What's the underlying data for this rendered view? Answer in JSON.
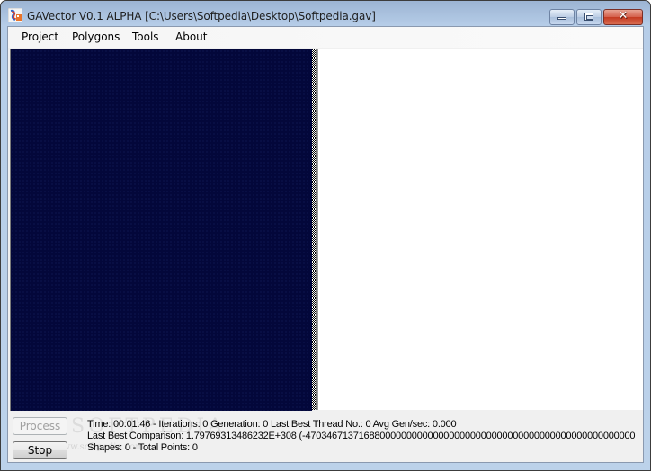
{
  "window": {
    "title": "GAVector V0.1 ALPHA [C:\\Users\\Softpedia\\Desktop\\Softpedia.gav]",
    "icon": "app-icon",
    "controls": {
      "minimize": "minimize-icon",
      "maximize": "maximize-icon",
      "close": "close-icon",
      "close_glyph": "✕"
    }
  },
  "menu": {
    "items": [
      {
        "label": "Project"
      },
      {
        "label": "Polygons"
      },
      {
        "label": "Tools"
      },
      {
        "label": "About"
      }
    ]
  },
  "canvas": {
    "source_color": "#03073a",
    "result_color": "#ffffff"
  },
  "controls": {
    "process_label": "Process",
    "process_enabled": false,
    "stop_label": "Stop"
  },
  "status": {
    "line1": "Time: 00:01:46 - Iterations: 0 Generation: 0 Last Best Thread No.: 0 Avg Gen/sec: 0.000",
    "line2": "Last Best Comparison: 1.79769313486232E+308 (-47034671371688000000000000000000000000000000000000000000000000",
    "line3": "Shapes: 0 - Total Points: 0"
  },
  "watermark": {
    "text": "SOFTPEDIA",
    "sub": "www.softpedia.com"
  }
}
